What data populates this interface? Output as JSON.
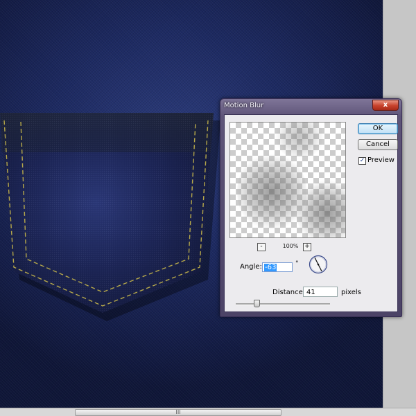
{
  "dialog": {
    "title": "Motion Blur",
    "close_label": "x",
    "ok_label": "OK",
    "cancel_label": "Cancel",
    "preview_label": "Preview",
    "preview_checked": true,
    "zoom": {
      "minus": "-",
      "plus": "+",
      "level": "100%"
    },
    "angle": {
      "label": "Angle:",
      "value": "-63",
      "unit": "°"
    },
    "distance": {
      "label": "Distance:",
      "value": "41",
      "unit": "pixels",
      "slider_fraction": 0.22
    }
  },
  "icons": {
    "close": "close-icon",
    "dial": "angle-dial-icon",
    "check": "checkmark-icon",
    "grip": "scroll-grip-icon"
  },
  "colors": {
    "denim": "#1d2a62",
    "stitch": "#c9b84a",
    "dialog_frame": "#5e5478",
    "close_red": "#c8422c",
    "selection": "#3399ff"
  },
  "scrollbar": {
    "grip": "III"
  }
}
